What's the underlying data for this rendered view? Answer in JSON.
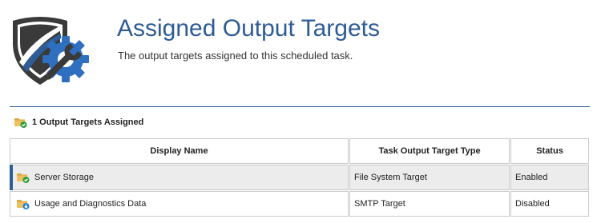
{
  "header": {
    "title": "Assigned Output Targets",
    "subtitle": "The output targets assigned to this scheduled task."
  },
  "logo_icon": "shield-gear-wrench-logo",
  "section": {
    "label": "1 Output Targets Assigned",
    "icon": "folder-check-icon"
  },
  "table": {
    "columns": [
      "Display Name",
      "Task Output Target Type",
      "Status"
    ],
    "rows": [
      {
        "name": "Server Storage",
        "type": "File System Target",
        "status": "Enabled",
        "icon": "folder-check-icon",
        "selected": true
      },
      {
        "name": "Usage and Diagnostics Data",
        "type": "SMTP Target",
        "status": "Disabled",
        "icon": "folder-download-icon",
        "selected": false
      }
    ]
  },
  "colors": {
    "accent": "#2e5c95",
    "selected_row_bg": "#ececec",
    "enabled_badge": "#2e9e3a",
    "download_badge": "#1e7fd4"
  }
}
